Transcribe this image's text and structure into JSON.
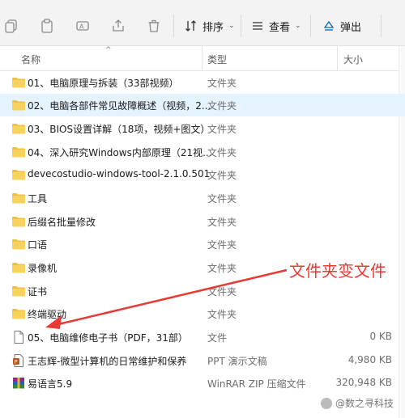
{
  "toolbar": {
    "sort_label": "排序",
    "view_label": "查看",
    "eject_label": "弹出"
  },
  "columns": {
    "name": "名称",
    "type": "类型",
    "size": "大小"
  },
  "files": [
    {
      "name": "01、电脑原理与拆装（33部视频）",
      "type": "文件夹",
      "size": "",
      "icon": "folder-icon"
    },
    {
      "name": "02、电脑各部件常见故障概述（视频，2...",
      "type": "文件夹",
      "size": "",
      "icon": "folder-icon"
    },
    {
      "name": "03、BIOS设置详解（18项，视频+图文）",
      "type": "文件夹",
      "size": "",
      "icon": "folder-icon"
    },
    {
      "name": "04、深入研究Windows内部原理（21视...",
      "type": "文件夹",
      "size": "",
      "icon": "folder-icon"
    },
    {
      "name": "devecostudio-windows-tool-2.1.0.501",
      "type": "文件夹",
      "size": "",
      "icon": "folder-icon"
    },
    {
      "name": "工具",
      "type": "文件夹",
      "size": "",
      "icon": "folder-icon"
    },
    {
      "name": "后缀名批量修改",
      "type": "文件夹",
      "size": "",
      "icon": "folder-icon"
    },
    {
      "name": "口语",
      "type": "文件夹",
      "size": "",
      "icon": "folder-icon"
    },
    {
      "name": "录像机",
      "type": "文件夹",
      "size": "",
      "icon": "folder-icon"
    },
    {
      "name": "证书",
      "type": "文件夹",
      "size": "",
      "icon": "folder-icon"
    },
    {
      "name": "终端驱动",
      "type": "文件夹",
      "size": "",
      "icon": "folder-icon"
    },
    {
      "name": "05、电脑维修电子书（PDF，31部）",
      "type": "文件",
      "size": "0 KB",
      "icon": "file-icon"
    },
    {
      "name": "王志辉-微型计算机的日常维护和保养",
      "type": "PPT 演示文稿",
      "size": "4,980 KB",
      "icon": "ppt-icon"
    },
    {
      "name": "易语言5.9",
      "type": "WinRAR ZIP 压缩文件",
      "size": "320,948 KB",
      "icon": "zip-icon"
    }
  ],
  "annotation": {
    "text": "文件夹变文件",
    "color": "#e83a32"
  },
  "watermark": "@数之寻科技",
  "colors": {
    "folder": "#f0c040",
    "selected_row": "#e5f3ff",
    "accent": "#0067c0"
  }
}
